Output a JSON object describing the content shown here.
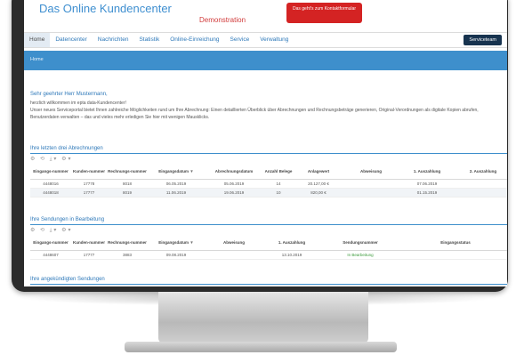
{
  "app": {
    "title": "Das Online Kundencenter",
    "demo_label": "Demonstration",
    "cta_label": "Das geht's zum Kontaktformular"
  },
  "nav": {
    "items": [
      "Home",
      "Datencenter",
      "Nachrichten",
      "Statistik",
      "Online-Einreichung",
      "Service",
      "Verwaltung"
    ],
    "active": "Home",
    "service_button": "Serviceteam"
  },
  "breadcrumb": "Home",
  "welcome": {
    "greeting": "Sehr geehrter Herr Mustermann,",
    "line1": "herzlich willkommen im epta data-Kundencenter!",
    "line2": "Unser neues Serviceportal bietet Ihnen zahlreiche Möglichkeiten rund um Ihre Abrechnung: Einen detaillierten Überblick über Abrechnungen und Rechnungsbeträge generieren, Original-Verordnungen als digitale Kopien abrufen, Benutzerdaten verwalten – das und vieles mehr erledigen Sie hier mit wenigen Mausklicks."
  },
  "section1": {
    "title": "Ihre letzten drei Abrechnungen",
    "columns": [
      "Eingangs-nummer",
      "Kunden-nummer",
      "Rechnungs-nummer",
      "Eingangsdatum",
      "Abrechnungsdatum",
      "Anzahl Belege",
      "Anlagewert",
      "Abweisung",
      "1. Auszahlung",
      "2. Auszahlung"
    ],
    "rows": [
      [
        "4448016",
        "17778",
        "8018",
        "06.05.2019",
        "05.06.2019",
        "14",
        "20.127,00 €",
        "",
        "07.06.2019",
        ""
      ],
      [
        "4448018",
        "17777",
        "8019",
        "11.06.2019",
        "19.06.2019",
        "10",
        "820,00 €",
        "",
        "01.15.2019",
        ""
      ]
    ]
  },
  "section2": {
    "title": "Ihre Sendungen in Bearbeitung",
    "columns": [
      "Eingangs-nummer",
      "Kunden-nummer",
      "Rechnungs-nummer",
      "Eingangsdatum",
      "Abweisung",
      "1. Auszahlung",
      "Sendungsnummer",
      "Eingangsstatus"
    ],
    "rows": [
      [
        "4448607",
        "17777",
        "3883",
        "09.08.2019",
        "",
        "13.10.2019",
        "In Bearbeitung",
        ""
      ]
    ]
  },
  "section3": {
    "title": "Ihre angekündigten Sendungen"
  },
  "toolbar": {
    "icons": [
      "filter-icon",
      "reset-icon",
      "export-icon",
      "settings-icon"
    ],
    "glyphs": "⚙ ⟲  ⤓▾ ⚙▾"
  },
  "colors": {
    "accent_blue": "#3e8fcc",
    "nav_dark": "#17334f",
    "cta_red": "#d42323",
    "bezel": "#2b2b2b"
  }
}
